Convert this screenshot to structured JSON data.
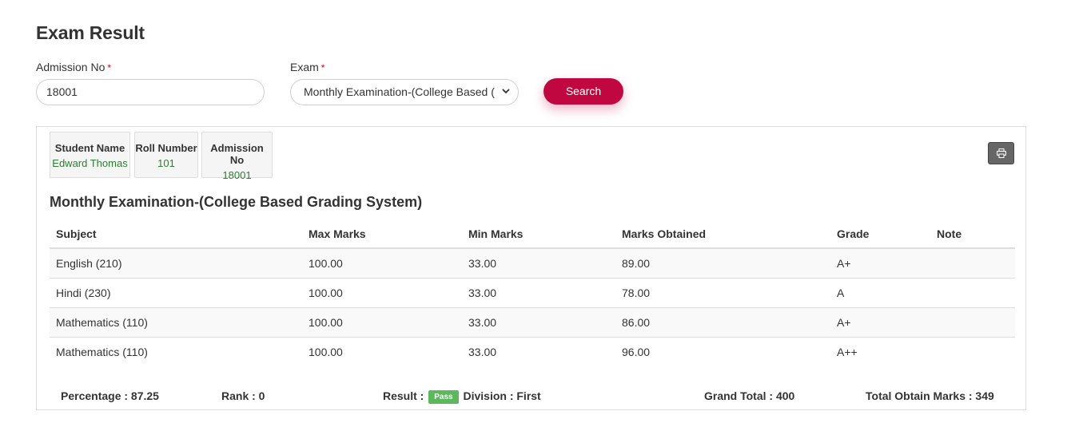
{
  "page": {
    "title": "Exam Result"
  },
  "form": {
    "admission_label": "Admission No",
    "admission_value": "18001",
    "exam_label": "Exam",
    "exam_selected": "Monthly Examination-(College Based (",
    "required_mark": "*",
    "search_label": "Search"
  },
  "student": {
    "name_label": "Student Name",
    "name": "Edward Thomas",
    "roll_label": "Roll Number",
    "roll": "101",
    "admission_label": "Admission No",
    "admission": "18001"
  },
  "exam_title": "Monthly Examination-(College Based Grading System)",
  "table": {
    "headers": [
      "Subject",
      "Max Marks",
      "Min Marks",
      "Marks Obtained",
      "Grade",
      "Note"
    ],
    "rows": [
      [
        "English (210)",
        "100.00",
        "33.00",
        "89.00",
        "A+",
        ""
      ],
      [
        "Hindi (230)",
        "100.00",
        "33.00",
        "78.00",
        "A",
        ""
      ],
      [
        "Mathematics (110)",
        "100.00",
        "33.00",
        "86.00",
        "A+",
        ""
      ],
      [
        "Mathematics (110)",
        "100.00",
        "33.00",
        "96.00",
        "A++",
        ""
      ]
    ]
  },
  "summary": {
    "percentage": "Percentage : 87.25",
    "rank": "Rank : 0",
    "result_label": "Result :",
    "result_badge": "Pass",
    "division": "Division : First",
    "grand_total": "Grand Total : 400",
    "total_obtain": "Total Obtain Marks : 349"
  },
  "icons": {
    "print": "print-icon",
    "dropdown": "chevron-down-icon"
  },
  "colors": {
    "accent": "#c1073f",
    "pass": "#5cb85c",
    "value_green": "#2e7d32"
  }
}
